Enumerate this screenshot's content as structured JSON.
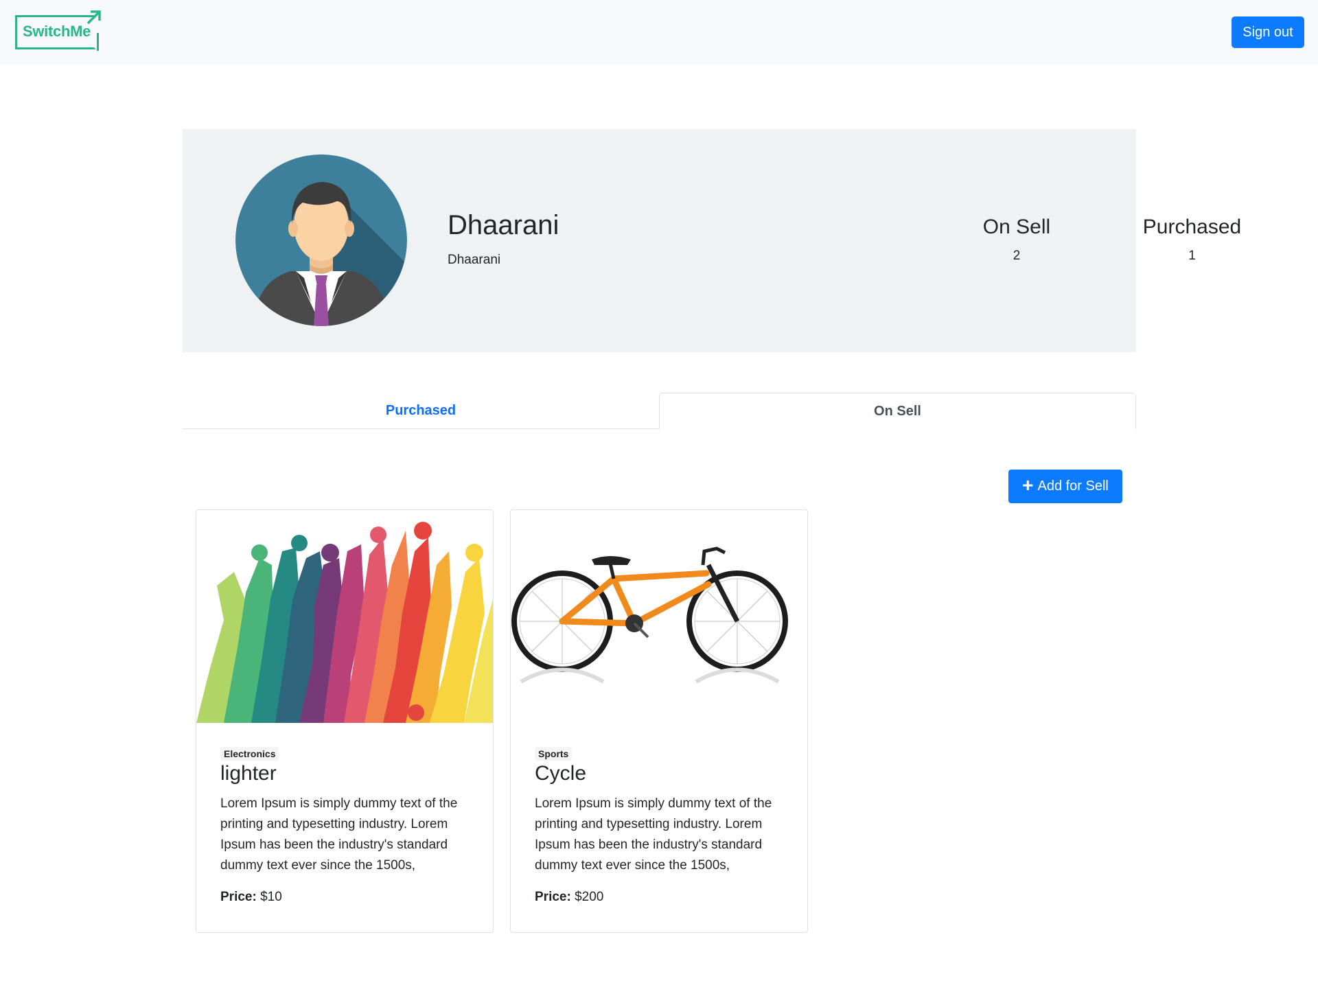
{
  "nav": {
    "logo_text": "SwitchMe",
    "signout_label": "Sign out"
  },
  "profile": {
    "name": "Dhaarani",
    "username": "Dhaarani",
    "stats": {
      "on_sell_label": "On Sell",
      "on_sell_value": "2",
      "purchased_label": "Purchased",
      "purchased_value": "1"
    }
  },
  "tabs": {
    "purchased": "Purchased",
    "on_sell": "On Sell",
    "active": "On Sell"
  },
  "actions": {
    "add_icon": "+",
    "add_label": "Add for Sell"
  },
  "products": [
    {
      "category": "Electronics",
      "title": "lighter",
      "description": "Lorem Ipsum is simply dummy text of the printing and typesetting industry. Lorem Ipsum has been the industry's standard dummy text ever since the 1500s,",
      "price_label": "Price:",
      "price": "$10",
      "image": "colorful-sports-silhouettes"
    },
    {
      "category": "Sports",
      "title": "Cycle",
      "description": "Lorem Ipsum is simply dummy text of the printing and typesetting industry. Lorem Ipsum has been the industry's standard dummy text ever since the 1500s,",
      "price_label": "Price:",
      "price": "$200",
      "image": "orange-bicycle"
    }
  ],
  "colors": {
    "brand": "#2bb58a",
    "primary": "#0d7bff",
    "tab_active_text": "#0d6efd",
    "profile_bg": "#eff2f3"
  }
}
